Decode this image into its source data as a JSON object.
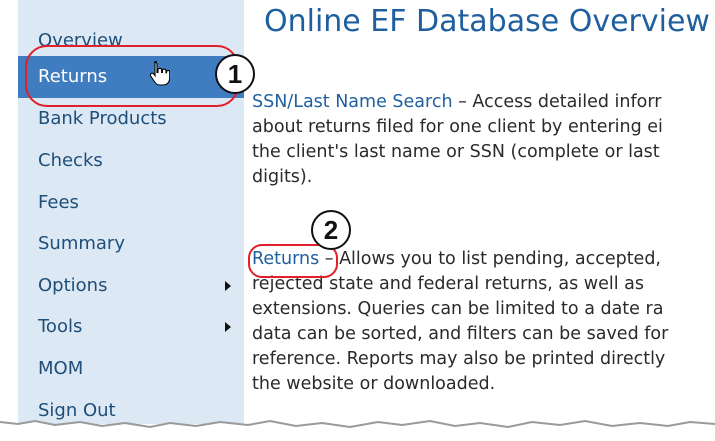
{
  "sidebar": {
    "items": [
      {
        "label": "Overview"
      },
      {
        "label": "Returns"
      },
      {
        "label": "Bank Products"
      },
      {
        "label": "Checks"
      },
      {
        "label": "Fees"
      },
      {
        "label": "Summary"
      },
      {
        "label": "Options"
      },
      {
        "label": "Tools"
      },
      {
        "label": "MOM"
      },
      {
        "label": "Sign Out"
      }
    ],
    "active_item": "Returns"
  },
  "content": {
    "title": "Online EF Database Overview",
    "search_link": "SSN/Last Name Search",
    "search_lines": [
      " – Access detailed inforr",
      "about returns filed for one client by entering ei",
      "the client's last name or SSN (complete or last",
      "digits)."
    ],
    "returns_link": "Returns",
    "returns_lines": [
      " – Allows you to list pending, accepted,",
      "rejected state and federal returns, as well as",
      "extensions.  Queries can be limited to a date ra",
      "data can be sorted, and filters can be saved for",
      "reference.  Reports may also be printed directly",
      "the website or downloaded."
    ]
  },
  "callouts": {
    "one": "1",
    "two": "2"
  },
  "colors": {
    "sidebar_bg": "#dce8f4",
    "active_bg": "#3f7cc0",
    "link": "#1f5f9f",
    "callout": "#e0202a"
  }
}
